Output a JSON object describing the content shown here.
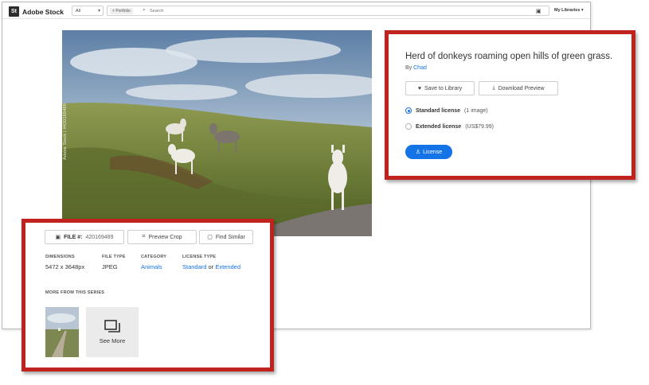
{
  "header": {
    "logo_badge": "St",
    "logo_text": "Adobe Stock",
    "filter_value": "All",
    "filter_icon": "chevron-down-icon",
    "chip_label": "Portfolio",
    "search_placeholder": "Search",
    "libraries_label": "My Libraries"
  },
  "image": {
    "watermark": "Adobe Stock | #420169489"
  },
  "detail": {
    "title": "Herd of donkeys roaming open hills of green grass.",
    "by_label": "By",
    "author": "Chad",
    "save_label": "Save to Library",
    "download_label": "Download Preview",
    "standard_label": "Standard license",
    "standard_note": "(1 image)",
    "extended_label": "Extended license",
    "extended_note": "(US$79.99)",
    "license_button": "License"
  },
  "meta": {
    "file_label": "FILE #:",
    "file_number": "420169489",
    "preview_crop": "Preview Crop",
    "find_similar": "Find Similar",
    "dimensions_label": "DIMENSIONS",
    "dimensions_value": "5472 x 3648px",
    "filetype_label": "FILE TYPE",
    "filetype_value": "JPEG",
    "category_label": "CATEGORY",
    "category_value": "Animals",
    "licensetype_label": "LICENSE TYPE",
    "license_standard": "Standard",
    "license_or": "or",
    "license_extended": "Extended",
    "more_series_label": "MORE FROM THIS SERIES",
    "see_more": "See More"
  },
  "colors": {
    "accent": "#1473e6",
    "highlight_border": "#c0231d"
  }
}
